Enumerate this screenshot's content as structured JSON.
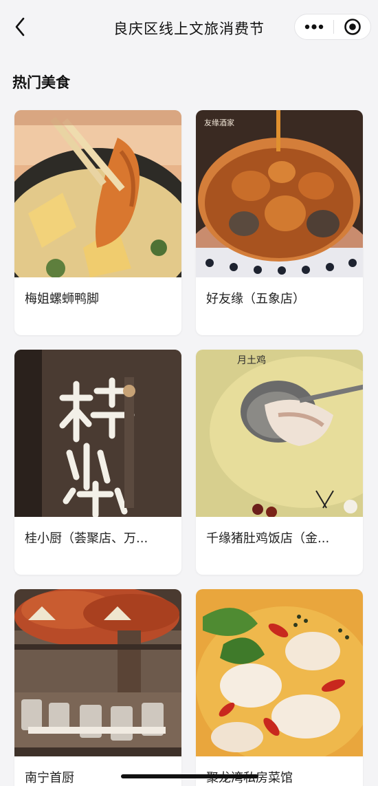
{
  "nav": {
    "title": "良庆区线上文旅消费节"
  },
  "section": {
    "title": "热门美食"
  },
  "cards": [
    {
      "name": "梅姐螺蛳鸭脚",
      "image": "hotpot-duck-feet-photo"
    },
    {
      "name": "好友缘（五象店）",
      "image": "braised-abalone-pot-photo"
    },
    {
      "name": "桂小厨（荟聚店、万...",
      "image": "restaurant-sign-photo"
    },
    {
      "name": "千缘猪肚鸡饭店（金...",
      "image": "pork-tripe-chicken-soup-photo"
    },
    {
      "name": "南宁首厨",
      "image": "restaurant-dining-hall-photo"
    },
    {
      "name": "聚龙湾私房菜馆",
      "image": "spicy-fish-dish-photo"
    }
  ],
  "colors": {
    "background": "#f4f4f6",
    "card": "#ffffff",
    "text": "#222222"
  }
}
